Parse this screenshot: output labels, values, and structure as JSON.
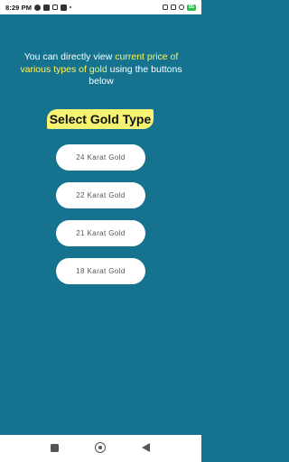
{
  "status_bar": {
    "time": "8:29 PM",
    "battery": "55"
  },
  "intro": {
    "text_before": "You can directly view ",
    "highlight": "current price of various types of gold",
    "text_after": " using the buttons below"
  },
  "title": "Select Gold Type",
  "buttons": [
    {
      "label": "24 Karat Gold"
    },
    {
      "label": "22 Karat Gold"
    },
    {
      "label": "21 Karat Gold"
    },
    {
      "label": "18 Karat Gold"
    }
  ],
  "colors": {
    "background": "#15738f",
    "highlight_text": "#fff35c",
    "title_background": "#f8f370"
  },
  "icons": {
    "nav": [
      "recent-apps-icon",
      "home-icon",
      "back-icon"
    ]
  }
}
